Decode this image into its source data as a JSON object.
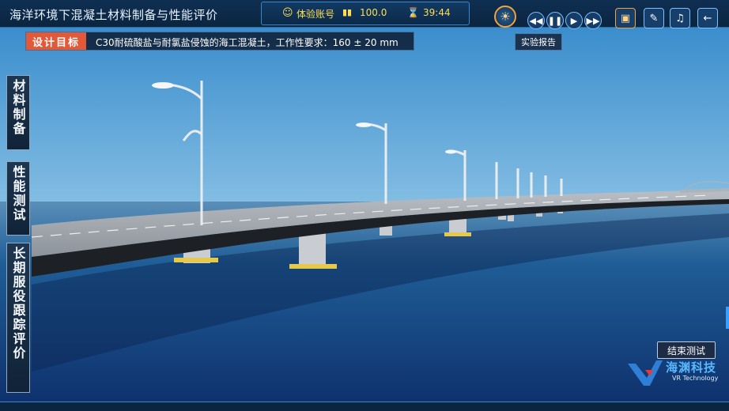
{
  "app": {
    "title": "海洋环境下混凝土材料制备与性能评价"
  },
  "status": {
    "account_label": "体验账号",
    "score": "100.0",
    "timer": "39:44"
  },
  "controls": {
    "report_label": "实验报告",
    "buttons": [
      "rewind-icon",
      "pause-icon",
      "play-icon",
      "fast-forward-icon"
    ],
    "tools": [
      "screen-play-icon",
      "notes-icon",
      "sound-icon",
      "back-arrow-icon"
    ]
  },
  "goal": {
    "tag": "设计目标",
    "text": "C30耐硫酸盐与耐氯盐侵蚀的海工混凝土，工作性要求：160 ± 20 mm"
  },
  "side_menu": {
    "items": [
      {
        "label": "材料制备"
      },
      {
        "label": "性能测试"
      },
      {
        "label": "长期服役跟踪评价"
      }
    ]
  },
  "end_test": {
    "label": "结束测试"
  },
  "logo": {
    "main": "海渊科技",
    "sub": "VR Technology",
    "brand_color": "#59b8ff"
  },
  "colors": {
    "accent": "#e2593a",
    "frame": "#3a86c8",
    "score": "#ffdd55"
  }
}
